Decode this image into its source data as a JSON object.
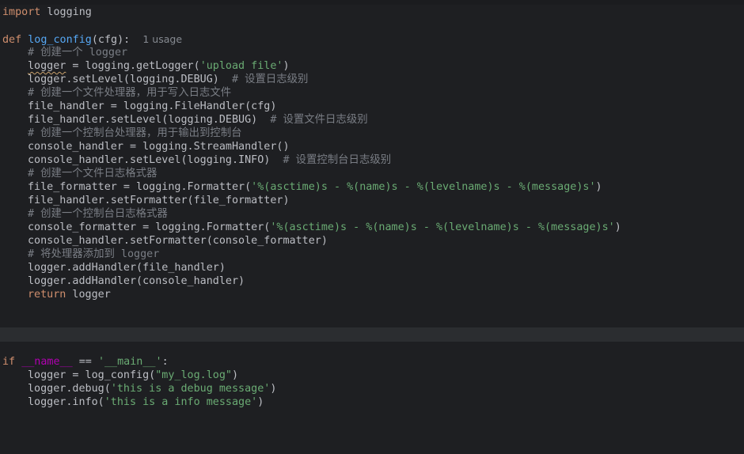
{
  "editor": {
    "block1": {
      "l1": [
        "import",
        " logging"
      ],
      "l2": [
        "def",
        " ",
        "log_config",
        "(cfg):",
        "1 usage"
      ],
      "l3": "# 创建一个 logger",
      "l4": [
        "logger",
        " = logging.getLogger(",
        "'upload file'",
        ")"
      ],
      "l5": [
        "logger.setLevel(logging.DEBUG)",
        "# 设置日志级别"
      ],
      "l6": "# 创建一个文件处理器，用于写入日志文件",
      "l7": "file_handler = logging.FileHandler(cfg)",
      "l8": [
        "file_handler.setLevel(logging.DEBUG)",
        "# 设置文件日志级别"
      ],
      "l9": "# 创建一个控制台处理器，用于输出到控制台",
      "l10": "console_handler = logging.StreamHandler()",
      "l11": [
        "console_handler.setLevel(logging.INFO)",
        "# 设置控制台日志级别"
      ],
      "l12": "# 创建一个文件日志格式器",
      "l13": [
        "file_formatter = logging.Formatter(",
        "'%(asctime)s - %(name)s - %(levelname)s - %(message)s'",
        ")"
      ],
      "l14": "file_handler.setFormatter(file_formatter)",
      "l15": "# 创建一个控制台日志格式器",
      "l16": [
        "console_formatter = logging.Formatter(",
        "'%(asctime)s - %(name)s - %(levelname)s - %(message)s'",
        ")"
      ],
      "l17": "console_handler.setFormatter(console_formatter)",
      "l18": "# 将处理器添加到 logger",
      "l19": "logger.addHandler(file_handler)",
      "l20": "logger.addHandler(console_handler)",
      "l21": [
        "return",
        " logger"
      ]
    },
    "block2": {
      "m1": [
        "if",
        " ",
        "__name__",
        " == ",
        "'__main__'",
        ":"
      ],
      "m2": [
        "logger = log_config(",
        "\"my_log.log\"",
        ")"
      ],
      "m3": [
        "logger.debug(",
        "'this is a debug message'",
        ")"
      ],
      "m4": [
        "logger.info(",
        "'this is a info message'",
        ")"
      ]
    }
  }
}
